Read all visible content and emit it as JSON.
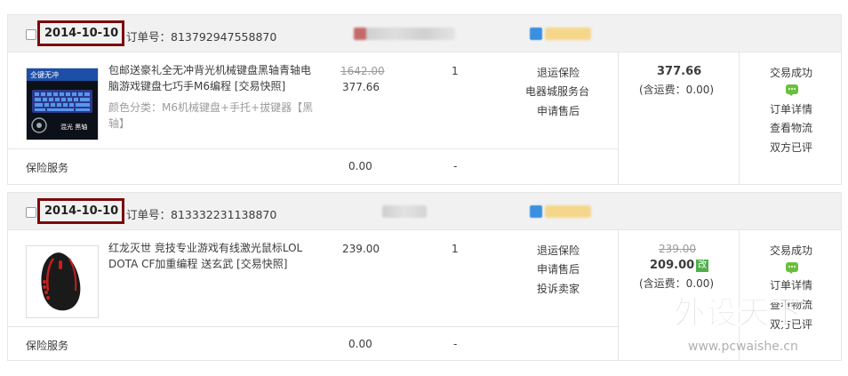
{
  "orders": [
    {
      "date": "2014-10-10",
      "order_no_label": "订单号：",
      "order_no": "813792947558870",
      "item": {
        "title": "包邮送豪礼全无冲背光机械键盘黑轴青轴电脑游戏键盘七巧手M6编程 [交易快照]",
        "spec": "颜色分类：M6机械键盘+手托+拔键器【黑轴】",
        "thumb_text_top": "全键无冲",
        "thumb_text_bottom": "混光  黑轴",
        "original_price": "1642.00",
        "price": "377.66",
        "quantity": "1",
        "actions": [
          "退运保险",
          "电器城服务台",
          "申请售后"
        ]
      },
      "service": {
        "label": "保险服务",
        "price": "0.00",
        "qty": "-"
      },
      "total": {
        "amount": "377.66",
        "shipping": "(含运费：0.00)"
      },
      "status": {
        "label": "交易成功",
        "links": [
          "订单详情",
          "查看物流",
          "双方已评"
        ]
      }
    },
    {
      "date": "2014-10-10",
      "order_no_label": "订单号：",
      "order_no": "813332231138870",
      "item": {
        "title": "红龙灭世 竞技专业游戏有线激光鼠标LOL DOTA CF加重编程 送玄武 [交易快照]",
        "price": "239.00",
        "quantity": "1",
        "actions": [
          "退运保险",
          "申请售后",
          "投诉卖家"
        ]
      },
      "service": {
        "label": "保险服务",
        "price": "0.00",
        "qty": "-"
      },
      "total": {
        "original": "239.00",
        "amount": "209.00",
        "edit_badge": "改",
        "shipping": "(含运费：0.00)"
      },
      "status": {
        "label": "交易成功",
        "links": [
          "订单详情",
          "查看物流",
          "双方已评"
        ]
      }
    }
  ],
  "watermark": {
    "main": "外设天下",
    "url": "www.pcwaishe.cn"
  }
}
